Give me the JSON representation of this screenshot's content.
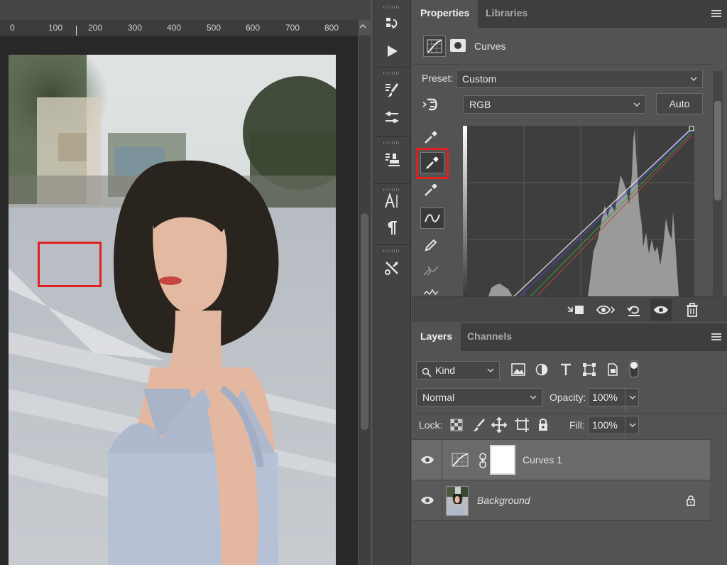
{
  "ruler": {
    "ticks": [
      "0",
      "100",
      "200",
      "300",
      "400",
      "500",
      "600",
      "700",
      "800"
    ]
  },
  "properties_panel": {
    "tabs": [
      {
        "label": "Properties"
      },
      {
        "label": "Libraries"
      }
    ],
    "adjustment_title": "Curves",
    "preset_label": "Preset:",
    "preset_value": "Custom",
    "channel_value": "RGB",
    "auto_button": "Auto"
  },
  "layers_panel": {
    "tabs": [
      {
        "label": "Layers"
      },
      {
        "label": "Channels"
      }
    ],
    "filter_kind": "Kind",
    "blend_mode": "Normal",
    "opacity_label": "Opacity:",
    "opacity_value": "100%",
    "lock_label": "Lock:",
    "fill_label": "Fill:",
    "fill_value": "100%",
    "layers": [
      {
        "name": "Curves 1",
        "selected": true
      },
      {
        "name": "Background",
        "selected": false,
        "locked": true
      }
    ]
  },
  "colors": {
    "accent_highlight": "#e02020",
    "panel_bg": "#535353",
    "dark_bg": "#282828"
  }
}
